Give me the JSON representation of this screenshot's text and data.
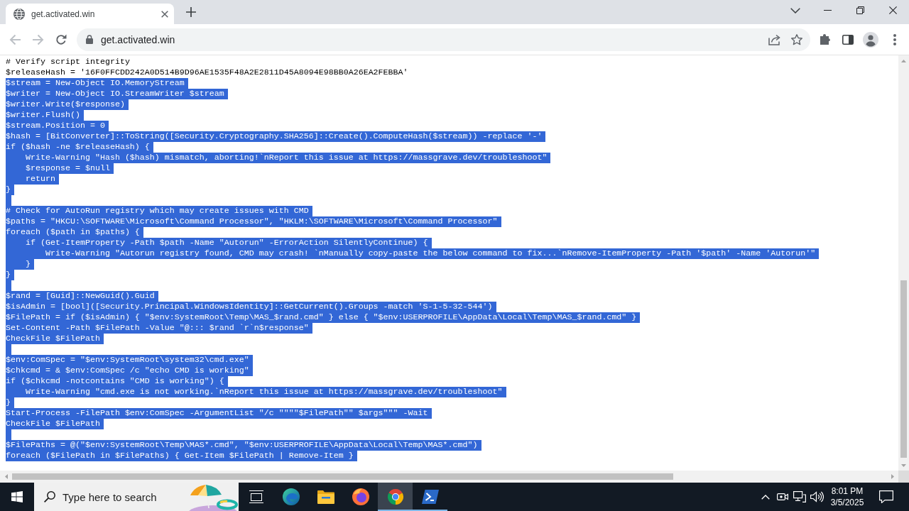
{
  "tabs": [
    {
      "title": "get.activated.win",
      "selected": true
    }
  ],
  "toolbar": {
    "nav": [
      {
        "kind": "back",
        "disabled": true
      },
      {
        "kind": "forward",
        "disabled": true
      },
      {
        "kind": "reload",
        "disabled": false
      }
    ],
    "address": "get.activated.win"
  },
  "page": {
    "lines": [
      {
        "kind": "code",
        "text": "# Verify script integrity",
        "selected": false
      },
      {
        "kind": "code",
        "text": "$releaseHash = '16F0FFCDD242A0D514B9D96AE1535F48A2E2811D45A8094E98BB0A26EA2FEBBA'",
        "selected": false
      },
      {
        "kind": "code",
        "text": "$stream = New-Object IO.MemoryStream",
        "selected": true
      },
      {
        "kind": "code",
        "text": "$writer = New-Object IO.StreamWriter $stream",
        "selected": true
      },
      {
        "kind": "code",
        "text": "$writer.Write($response)",
        "selected": true
      },
      {
        "kind": "code",
        "text": "$writer.Flush()",
        "selected": true
      },
      {
        "kind": "code",
        "text": "$stream.Position = 0",
        "selected": true
      },
      {
        "kind": "code",
        "text": "$hash = [BitConverter]::ToString([Security.Cryptography.SHA256]::Create().ComputeHash($stream)) -replace '-'",
        "selected": true
      },
      {
        "kind": "code",
        "text": "if ($hash -ne $releaseHash) {",
        "selected": true
      },
      {
        "kind": "code",
        "text": "    Write-Warning \"Hash ($hash) mismatch, aborting!`nReport this issue at https://massgrave.dev/troubleshoot\"",
        "selected": true
      },
      {
        "kind": "code",
        "text": "    $response = $null",
        "selected": true
      },
      {
        "kind": "code",
        "text": "    return",
        "selected": true
      },
      {
        "kind": "code",
        "text": "}",
        "selected": true
      },
      {
        "kind": "blank",
        "selected": true
      },
      {
        "kind": "code",
        "text": "# Check for AutoRun registry which may create issues with CMD",
        "selected": true
      },
      {
        "kind": "code",
        "text": "$paths = \"HKCU:\\SOFTWARE\\Microsoft\\Command Processor\", \"HKLM:\\SOFTWARE\\Microsoft\\Command Processor\"",
        "selected": true
      },
      {
        "kind": "code",
        "text": "foreach ($path in $paths) {",
        "selected": true
      },
      {
        "kind": "code",
        "text": "    if (Get-ItemProperty -Path $path -Name \"Autorun\" -ErrorAction SilentlyContinue) {",
        "selected": true
      },
      {
        "kind": "code",
        "text": "        Write-Warning \"Autorun registry found, CMD may crash! `nManually copy-paste the below command to fix...`nRemove-ItemProperty -Path '$path' -Name 'Autorun'\"",
        "selected": true
      },
      {
        "kind": "code",
        "text": "    }",
        "selected": true
      },
      {
        "kind": "code",
        "text": "}",
        "selected": true
      },
      {
        "kind": "blank",
        "selected": true
      },
      {
        "kind": "code",
        "text": "$rand = [Guid]::NewGuid().Guid",
        "selected": true
      },
      {
        "kind": "code",
        "text": "$isAdmin = [bool]([Security.Principal.WindowsIdentity]::GetCurrent().Groups -match 'S-1-5-32-544')",
        "selected": true
      },
      {
        "kind": "code",
        "text": "$FilePath = if ($isAdmin) { \"$env:SystemRoot\\Temp\\MAS_$rand.cmd\" } else { \"$env:USERPROFILE\\AppData\\Local\\Temp\\MAS_$rand.cmd\" }",
        "selected": true
      },
      {
        "kind": "code",
        "text": "Set-Content -Path $FilePath -Value \"@::: $rand `r`n$response\"",
        "selected": true
      },
      {
        "kind": "code",
        "text": "CheckFile $FilePath",
        "selected": true
      },
      {
        "kind": "blank",
        "selected": true
      },
      {
        "kind": "code",
        "text": "$env:ComSpec = \"$env:SystemRoot\\system32\\cmd.exe\"",
        "selected": true
      },
      {
        "kind": "code",
        "text": "$chkcmd = & $env:ComSpec /c \"echo CMD is working\"",
        "selected": true
      },
      {
        "kind": "code",
        "text": "if ($chkcmd -notcontains \"CMD is working\") {",
        "selected": true
      },
      {
        "kind": "code",
        "text": "    Write-Warning \"cmd.exe is not working.`nReport this issue at https://massgrave.dev/troubleshoot\"",
        "selected": true
      },
      {
        "kind": "code",
        "text": "}",
        "selected": true
      },
      {
        "kind": "code",
        "text": "Start-Process -FilePath $env:ComSpec -ArgumentList \"/c \"\"\"\"$FilePath\"\" $args\"\"\" -Wait",
        "selected": true
      },
      {
        "kind": "code",
        "text": "CheckFile $FilePath",
        "selected": true
      },
      {
        "kind": "blank",
        "selected": true
      },
      {
        "kind": "code",
        "text": "$FilePaths = @(\"$env:SystemRoot\\Temp\\MAS*.cmd\", \"$env:USERPROFILE\\AppData\\Local\\Temp\\MAS*.cmd\")",
        "selected": true
      },
      {
        "kind": "code",
        "text": "foreach ($FilePath in $FilePaths) { Get-Item $FilePath | Remove-Item }",
        "selected": true
      }
    ]
  },
  "taskbar": {
    "search": {
      "placeholder": "Type here to search"
    },
    "apps": [
      {
        "kind": "task-view",
        "selected": false,
        "running": false
      },
      {
        "kind": "edge",
        "selected": false,
        "running": false
      },
      {
        "kind": "explorer",
        "selected": false,
        "running": false
      },
      {
        "kind": "firefox",
        "selected": false,
        "running": false
      },
      {
        "kind": "chrome",
        "selected": true,
        "running": true
      },
      {
        "kind": "terminal",
        "selected": false,
        "running": true
      }
    ],
    "clock": {
      "time": "8:01 PM",
      "date": "3/5/2025"
    }
  }
}
